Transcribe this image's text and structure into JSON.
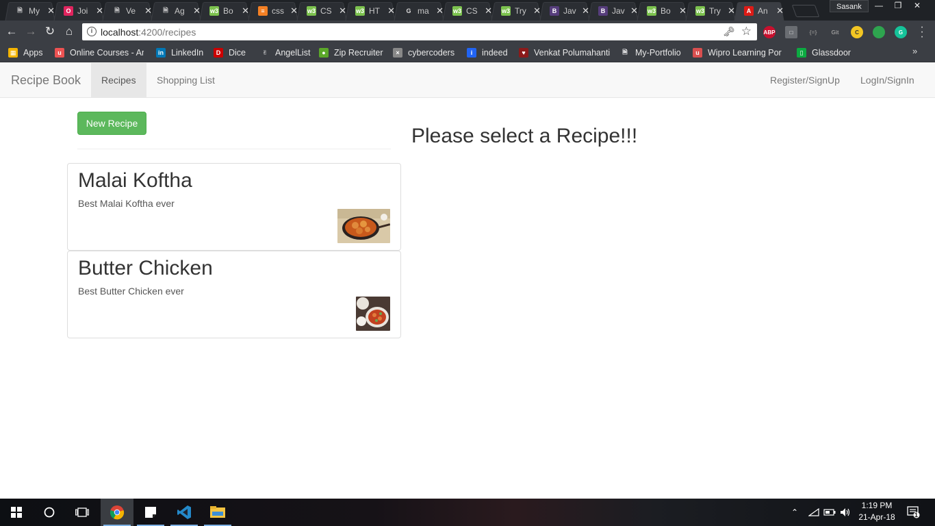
{
  "browser": {
    "tabs": [
      {
        "title": "My",
        "icon": "document-icon",
        "color": "#ffffff"
      },
      {
        "title": "Joi",
        "icon": "opera-icon",
        "color": "#e0245e"
      },
      {
        "title": "Ve",
        "icon": "document-icon",
        "color": "#ffffff"
      },
      {
        "title": "Ag",
        "icon": "document-icon",
        "color": "#ffffff"
      },
      {
        "title": "Bo",
        "icon": "w3schools-icon",
        "color": "#7cc24e"
      },
      {
        "title": "css",
        "icon": "stackoverflow-icon",
        "color": "#f48024"
      },
      {
        "title": "CS",
        "icon": "w3schools-icon",
        "color": "#7cc24e"
      },
      {
        "title": "HT",
        "icon": "w3schools-icon",
        "color": "#7cc24e"
      },
      {
        "title": "ma",
        "icon": "google-icon",
        "color": "#ffffff"
      },
      {
        "title": "CS",
        "icon": "w3schools-icon",
        "color": "#7cc24e"
      },
      {
        "title": "Try",
        "icon": "w3schools-icon",
        "color": "#7cc24e"
      },
      {
        "title": "Jav",
        "icon": "bootstrap-icon",
        "color": "#563d7c"
      },
      {
        "title": "Jav",
        "icon": "bootstrap-icon",
        "color": "#563d7c"
      },
      {
        "title": "Bo",
        "icon": "w3schools-icon",
        "color": "#7cc24e"
      },
      {
        "title": "Try",
        "icon": "w3schools-icon",
        "color": "#7cc24e"
      },
      {
        "title": "An",
        "icon": "angular-icon",
        "color": "#dd1b16"
      }
    ],
    "profile_name": "Sasank",
    "url_host": "localhost",
    "url_path": ":4200/recipes",
    "bookmarks": [
      {
        "label": "Apps",
        "icon": "apps-grid-icon"
      },
      {
        "label": "Online Courses - Any",
        "icon": "udemy-icon"
      },
      {
        "label": "LinkedIn",
        "icon": "linkedin-icon"
      },
      {
        "label": "Dice",
        "icon": "dice-icon"
      },
      {
        "label": "AngelList",
        "icon": "angellist-icon"
      },
      {
        "label": "Zip Recruiter",
        "icon": "ziprecruiter-icon"
      },
      {
        "label": "cybercoders",
        "icon": "cybercoders-icon"
      },
      {
        "label": "indeed",
        "icon": "indeed-icon"
      },
      {
        "label": "Venkat Polumahanti",
        "icon": "venkat-icon"
      },
      {
        "label": "My-Portfolio",
        "icon": "document-icon"
      },
      {
        "label": "Wipro Learning Portal",
        "icon": "wipro-icon"
      },
      {
        "label": "Glassdoor",
        "icon": "glassdoor-icon"
      }
    ]
  },
  "app": {
    "brand": "Recipe Book",
    "nav": {
      "recipes": "Recipes",
      "shopping_list": "Shopping List",
      "register": "Register/SignUp",
      "login": "LogIn/SignIn"
    },
    "new_recipe_label": "New Recipe",
    "recipes": [
      {
        "name": "Malai Koftha",
        "description": "Best Malai Koftha ever"
      },
      {
        "name": "Butter Chicken",
        "description": "Best Butter Chicken ever"
      }
    ],
    "detail_placeholder": "Please select a Recipe!!!"
  },
  "taskbar": {
    "time": "1:19 PM",
    "date": "21-Apr-18",
    "notification_count": "1"
  }
}
